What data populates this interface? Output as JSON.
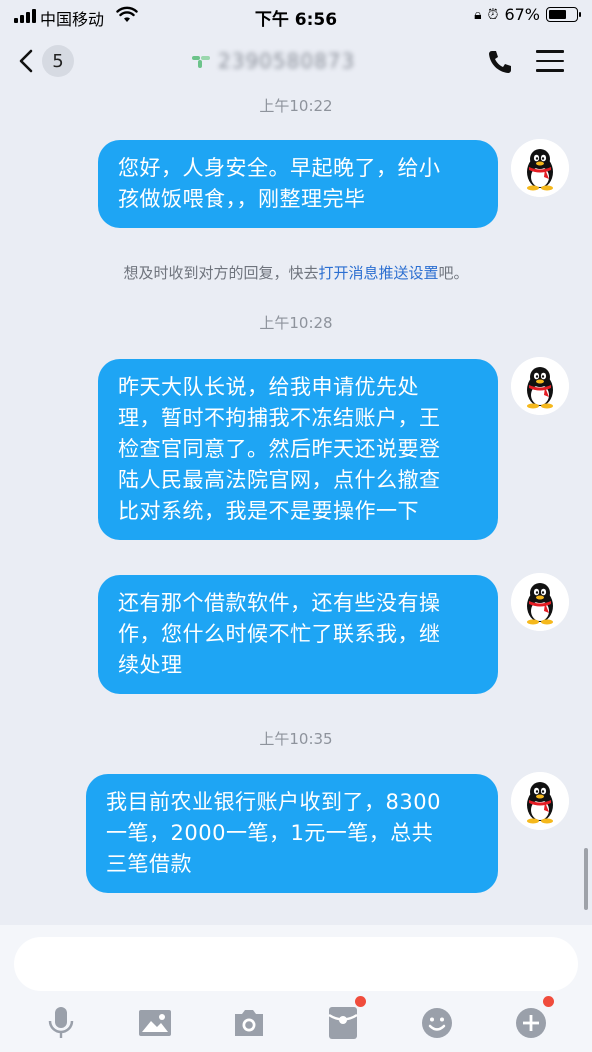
{
  "status_bar": {
    "carrier": "中国移动",
    "time": "下午 6:56",
    "battery_percent": "67%",
    "battery_level": 0.67
  },
  "header": {
    "unread_count": "5",
    "contact_name": "2390580873"
  },
  "messages": [
    {
      "type": "timestamp",
      "text": "上午10:22"
    },
    {
      "type": "outgoing",
      "text": "您好，人身安全。早起晚了，给小\n孩做饭喂食，，刚整理完毕"
    },
    {
      "type": "system",
      "text": "想及时收到对方的回复，快去",
      "link": "打开消息推送设置",
      "suffix": "吧。"
    },
    {
      "type": "timestamp",
      "text": "上午10:28"
    },
    {
      "type": "outgoing",
      "text": "昨天大队长说，给我申请优先处\n理，暂时不拘捕我不冻结账户，王\n检查官同意了。然后昨天还说要登\n陆人民最高法院官网，点什么撤查\n比对系统，我是不是要操作一下"
    },
    {
      "type": "outgoing",
      "text": "还有那个借款软件，还有些没有操\n作，您什么时候不忙了联系我，继\n续处理"
    },
    {
      "type": "timestamp",
      "text": "上午10:35"
    },
    {
      "type": "outgoing",
      "text": "我目前农业银行账户收到了，8300\n一笔，2000一笔，1元一笔，总共\n三笔借款"
    }
  ],
  "input": {
    "value": "",
    "placeholder": ""
  },
  "toolbar": {
    "items": [
      "microphone-icon",
      "image-icon",
      "camera-icon",
      "red-packet-icon",
      "emoji-icon",
      "plus-icon"
    ]
  },
  "colors": {
    "bubble": "#1ea5f4",
    "background": "#eaedf4",
    "link": "#2c6fd1",
    "badge_dot": "#f04c3c"
  }
}
